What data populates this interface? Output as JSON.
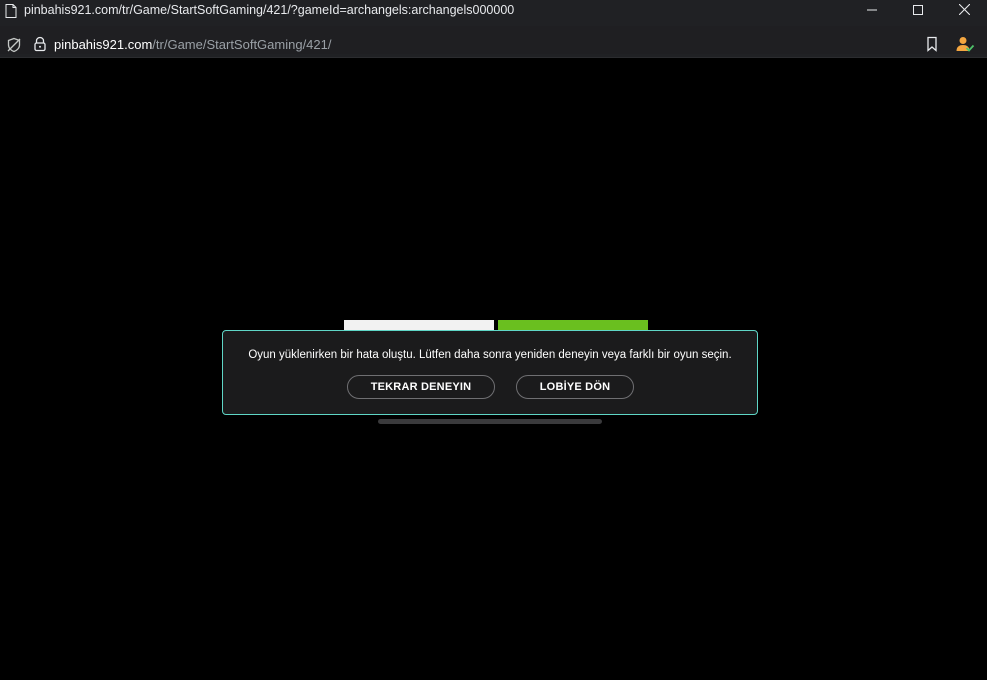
{
  "window": {
    "title": "pinbahis921.com/tr/Game/StartSoftGaming/421/?gameId=archangels:archangels000000"
  },
  "addressbar": {
    "url_host": "pinbahis921.com",
    "url_path": "/tr/Game/StartSoftGaming/421/"
  },
  "icons": {
    "site": "browser-site-icon",
    "minimize": "minimize-icon",
    "maximize": "maximize-icon",
    "close": "close-icon",
    "tracking": "tracking-protection-icon",
    "lock": "lock-icon",
    "bookmark": "bookmark-icon",
    "profile": "profile-icon"
  },
  "dialog": {
    "message": "Oyun yüklenirken bir hata oluştu. Lütfen daha sonra yeniden deneyin veya farklı bir oyun seçin.",
    "retry_label": "TEKRAR DENEYIN",
    "lobby_label": "LOBİYE DÖN"
  },
  "colors": {
    "chrome_bg": "#202124",
    "page_bg": "#000000",
    "dialog_bg": "#1b1b1c",
    "dialog_border": "#5fd6c6",
    "logo_green": "#6abf1f",
    "profile_accent": "#f4a640"
  }
}
